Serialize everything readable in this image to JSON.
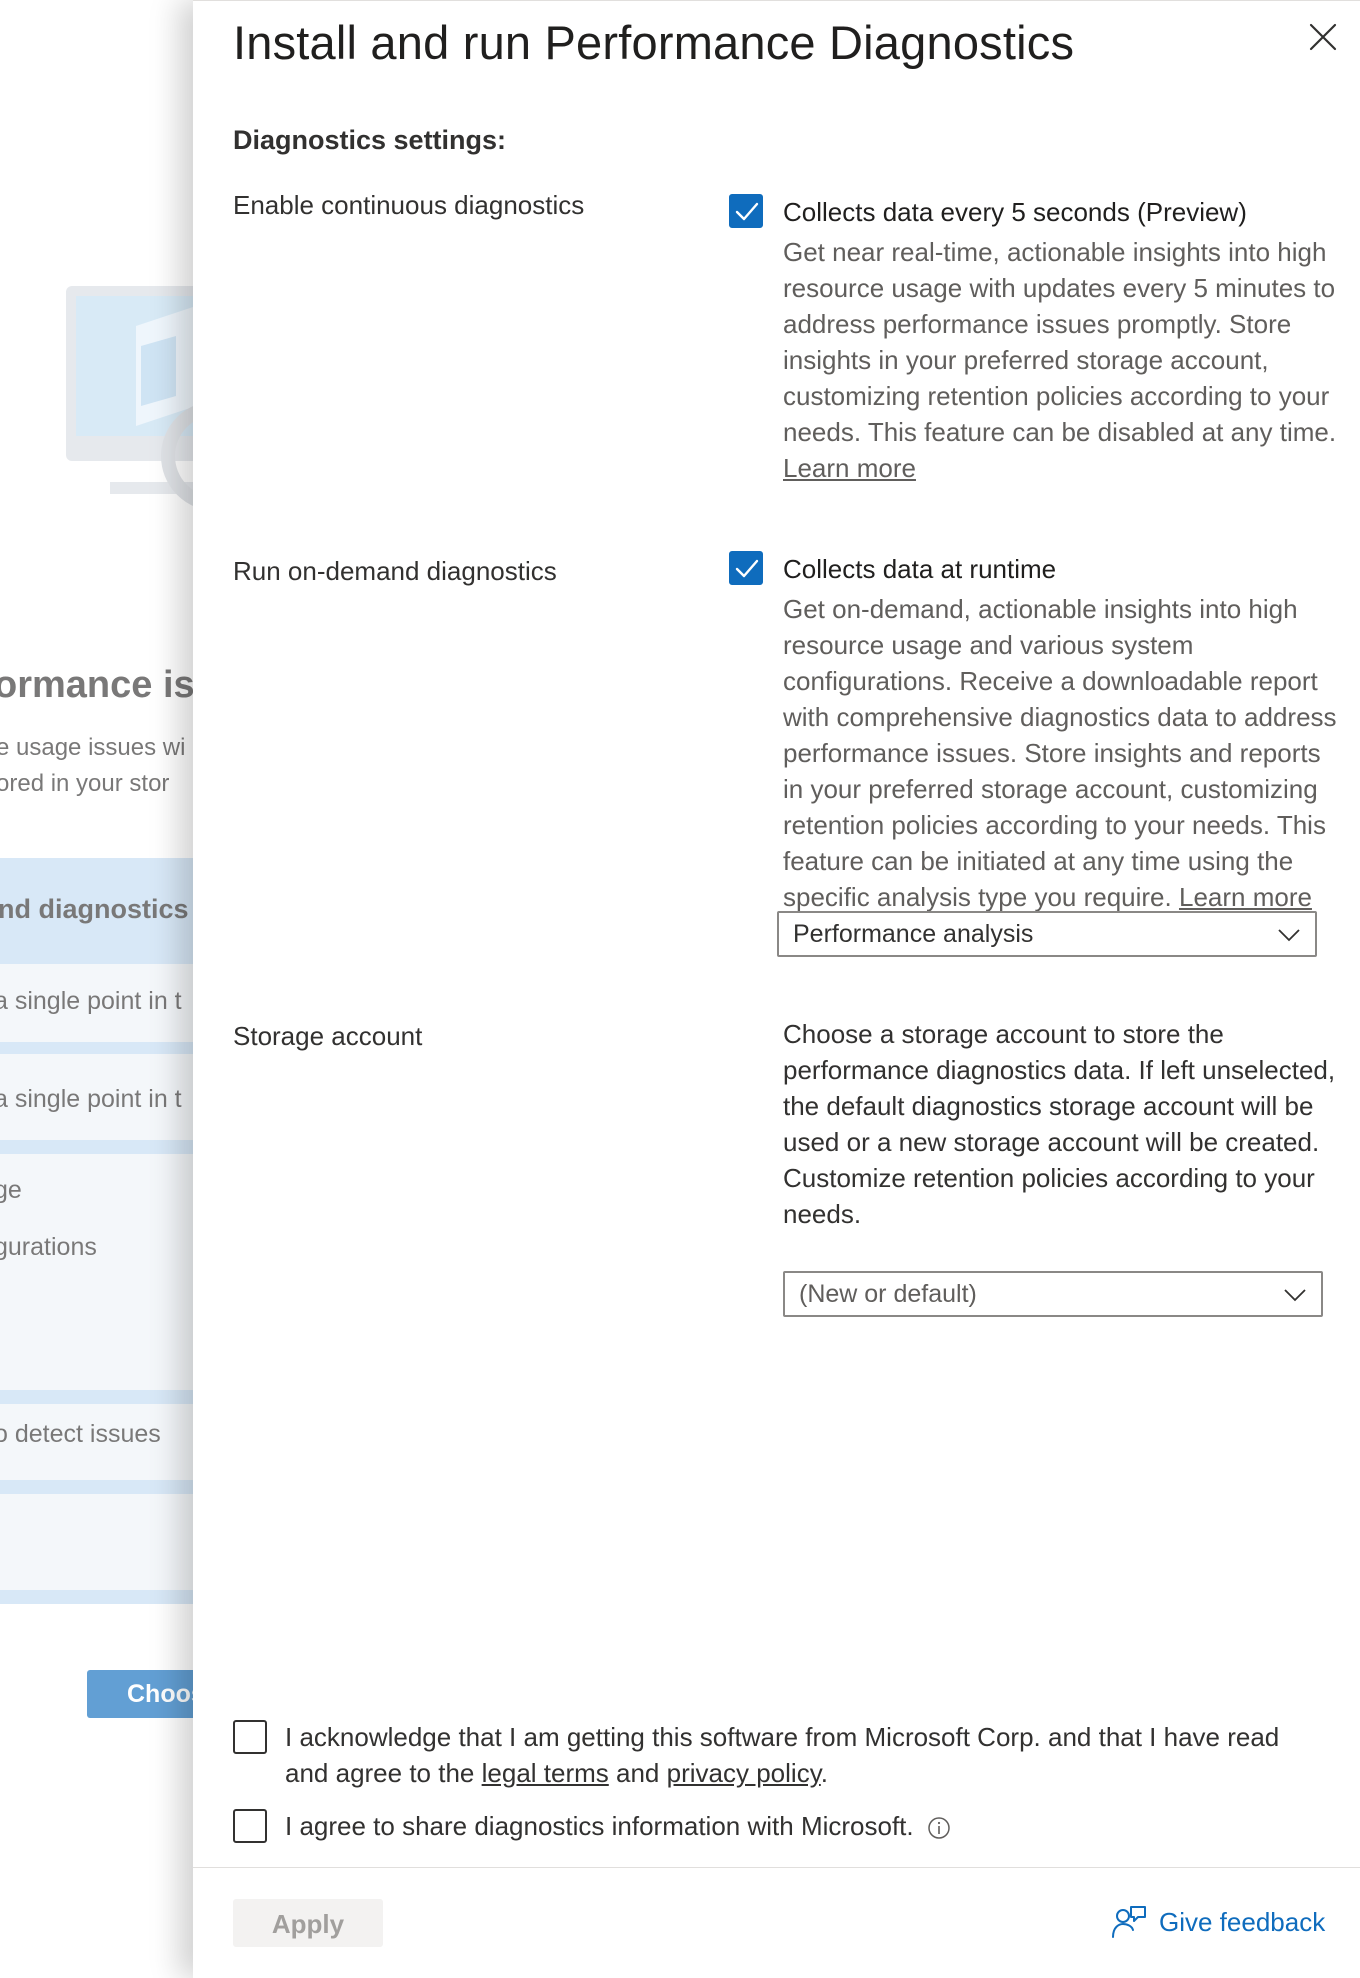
{
  "background": {
    "heading": "ormance is",
    "subtitle_lines": [
      "e usage issues wi",
      "ored in your stor"
    ],
    "card_title": "nd diagnostics",
    "items": [
      "a single point in t",
      "a single point in t",
      "ge",
      "gurations",
      "o detect issues"
    ],
    "button_label": "Choos"
  },
  "panel": {
    "title": "Install and run Performance Diagnostics",
    "section_title": "Diagnostics settings:",
    "continuous": {
      "label": "Enable continuous diagnostics",
      "checked": true,
      "option_title": "Collects data every 5 seconds (Preview)",
      "description": "Get near real-time, actionable insights into high resource usage with updates every 5 minutes to address performance issues promptly. Store insights in your preferred storage account, customizing retention policies according to your needs. This feature can be disabled at any time.",
      "learn_more": "Learn more"
    },
    "on_demand": {
      "label": "Run on-demand diagnostics",
      "checked": true,
      "option_title": "Collects data at runtime",
      "description": "Get on-demand, actionable insights into high resource usage and various system configurations. Receive a downloadable report with comprehensive diagnostics data to address performance issues. Store insights and reports in your preferred storage account, customizing retention policies according to your needs. This feature can be initiated at any time using the specific analysis type you require.",
      "learn_more": "Learn more",
      "analysis_type": "Performance analysis"
    },
    "storage": {
      "label": "Storage account",
      "description": "Choose a storage account to store the performance diagnostics data. If left unselected, the default diagnostics storage account will be used or a new storage account will be created. Customize retention policies according to your needs.",
      "selected": "(New or default)"
    },
    "acknowledge": {
      "checked": false,
      "text_before": "I acknowledge that I am getting this software from Microsoft Corp. and that I have read and agree to the",
      "legal_terms": "legal terms",
      "and": "and",
      "privacy_policy": "privacy policy",
      "period": "."
    },
    "share": {
      "checked": false,
      "text": "I agree to share diagnostics information with Microsoft."
    },
    "footer": {
      "apply_label": "Apply",
      "feedback_label": "Give feedback"
    }
  },
  "colors": {
    "accent": "#0f6cbd",
    "muted_text": "#605e5c",
    "text": "#323130",
    "disabled_bg": "#f3f2f1",
    "disabled_text": "#a19f9d"
  }
}
